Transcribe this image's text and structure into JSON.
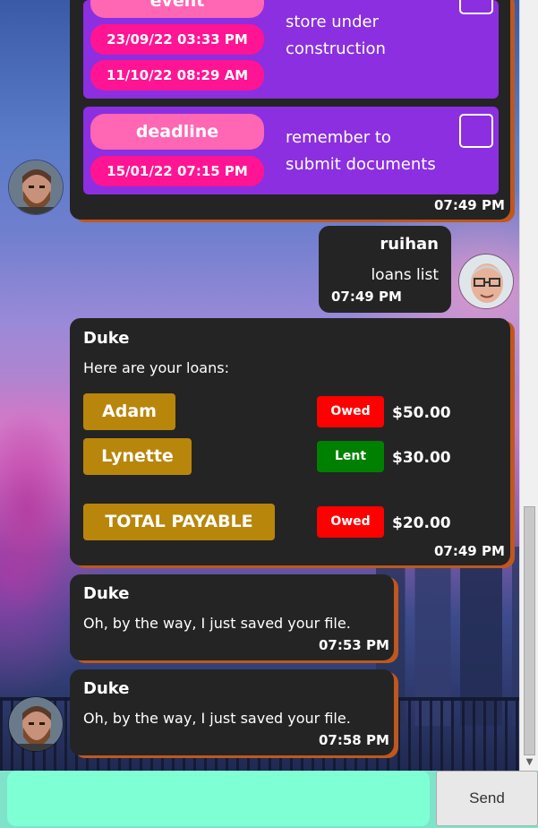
{
  "tasks": [
    {
      "type": "event",
      "dates": [
        "23/09/22 03:33 PM",
        "11/10/22 08:29 AM"
      ],
      "description": [
        "store under",
        "construction"
      ]
    },
    {
      "type": "deadline",
      "dates": [
        "15/01/22 07:15 PM"
      ],
      "description": [
        "remember to",
        "submit documents"
      ]
    }
  ],
  "messages": {
    "tasks_time": "07:49 PM",
    "user": {
      "name": "ruihan",
      "text": "loans list",
      "time": "07:49 PM"
    },
    "loans": {
      "name": "Duke",
      "intro": "Here are your loans:",
      "rows": [
        {
          "name": "Adam",
          "status": "Owed",
          "amount": "$50.00"
        },
        {
          "name": "Lynette",
          "status": "Lent",
          "amount": "$30.00"
        }
      ],
      "total": {
        "name": "TOTAL PAYABLE",
        "status": "Owed",
        "amount": "$20.00"
      },
      "time": "07:49 PM"
    },
    "saved1": {
      "name": "Duke",
      "text": "Oh, by the way, I just saved your file.",
      "time": "07:53 PM"
    },
    "saved2": {
      "name": "Duke",
      "text": "Oh, by the way, I just saved your file.",
      "time": "07:58 PM"
    }
  },
  "input": {
    "value": "",
    "send_label": "Send"
  },
  "colors": {
    "bubble": "#242424",
    "task_card": "#8b2fe0",
    "type_pill": "#ff66b3",
    "date_pill": "#ff1493",
    "loan_name": "#b8860b",
    "owed": "#ff0000",
    "lent": "#008000",
    "input": "#7fffd4"
  }
}
